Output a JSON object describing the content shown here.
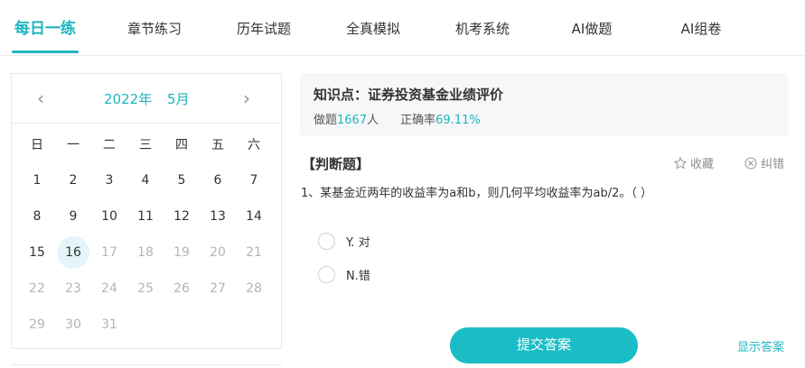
{
  "tabs": [
    {
      "label": "每日一练",
      "active": true
    },
    {
      "label": "章节练习",
      "active": false
    },
    {
      "label": "历年试题",
      "active": false
    },
    {
      "label": "全真模拟",
      "active": false
    },
    {
      "label": "机考系统",
      "active": false
    },
    {
      "label": "AI做题",
      "active": false
    },
    {
      "label": "AI组卷",
      "active": false
    }
  ],
  "calendar": {
    "year": "2022年",
    "month": "5月",
    "weekdays": [
      "日",
      "一",
      "二",
      "三",
      "四",
      "五",
      "六"
    ],
    "today": 16,
    "days": [
      [
        "1",
        "2",
        "3",
        "4",
        "5",
        "6",
        "7"
      ],
      [
        "8",
        "9",
        "10",
        "11",
        "12",
        "13",
        "14"
      ],
      [
        "15",
        "16",
        "17",
        "18",
        "19",
        "20",
        "21"
      ],
      [
        "22",
        "23",
        "24",
        "25",
        "26",
        "27",
        "28"
      ],
      [
        "29",
        "30",
        "31"
      ]
    ]
  },
  "knowledge": {
    "title": "知识点：证券投资基金业绩评价",
    "done_label": "做题",
    "done_count": "1667",
    "done_unit": "人",
    "accuracy_label": "正确率",
    "accuracy_value": "69.11%"
  },
  "question": {
    "type": "【判断题】",
    "favorite_label": "收藏",
    "report_label": "纠错",
    "text": "1、某基金近两年的收益率为a和b，则几何平均收益率为ab/2。（    ）",
    "options": [
      {
        "label": "Y. 对"
      },
      {
        "label": "N.错"
      }
    ]
  },
  "actions": {
    "submit_label": "提交答案",
    "show_answer_label": "显示答案"
  },
  "colors": {
    "accent": "#1fb5bf",
    "button": "#1abdc6",
    "today_bg": "#e3f5f8",
    "muted": "#b4b4b4"
  }
}
